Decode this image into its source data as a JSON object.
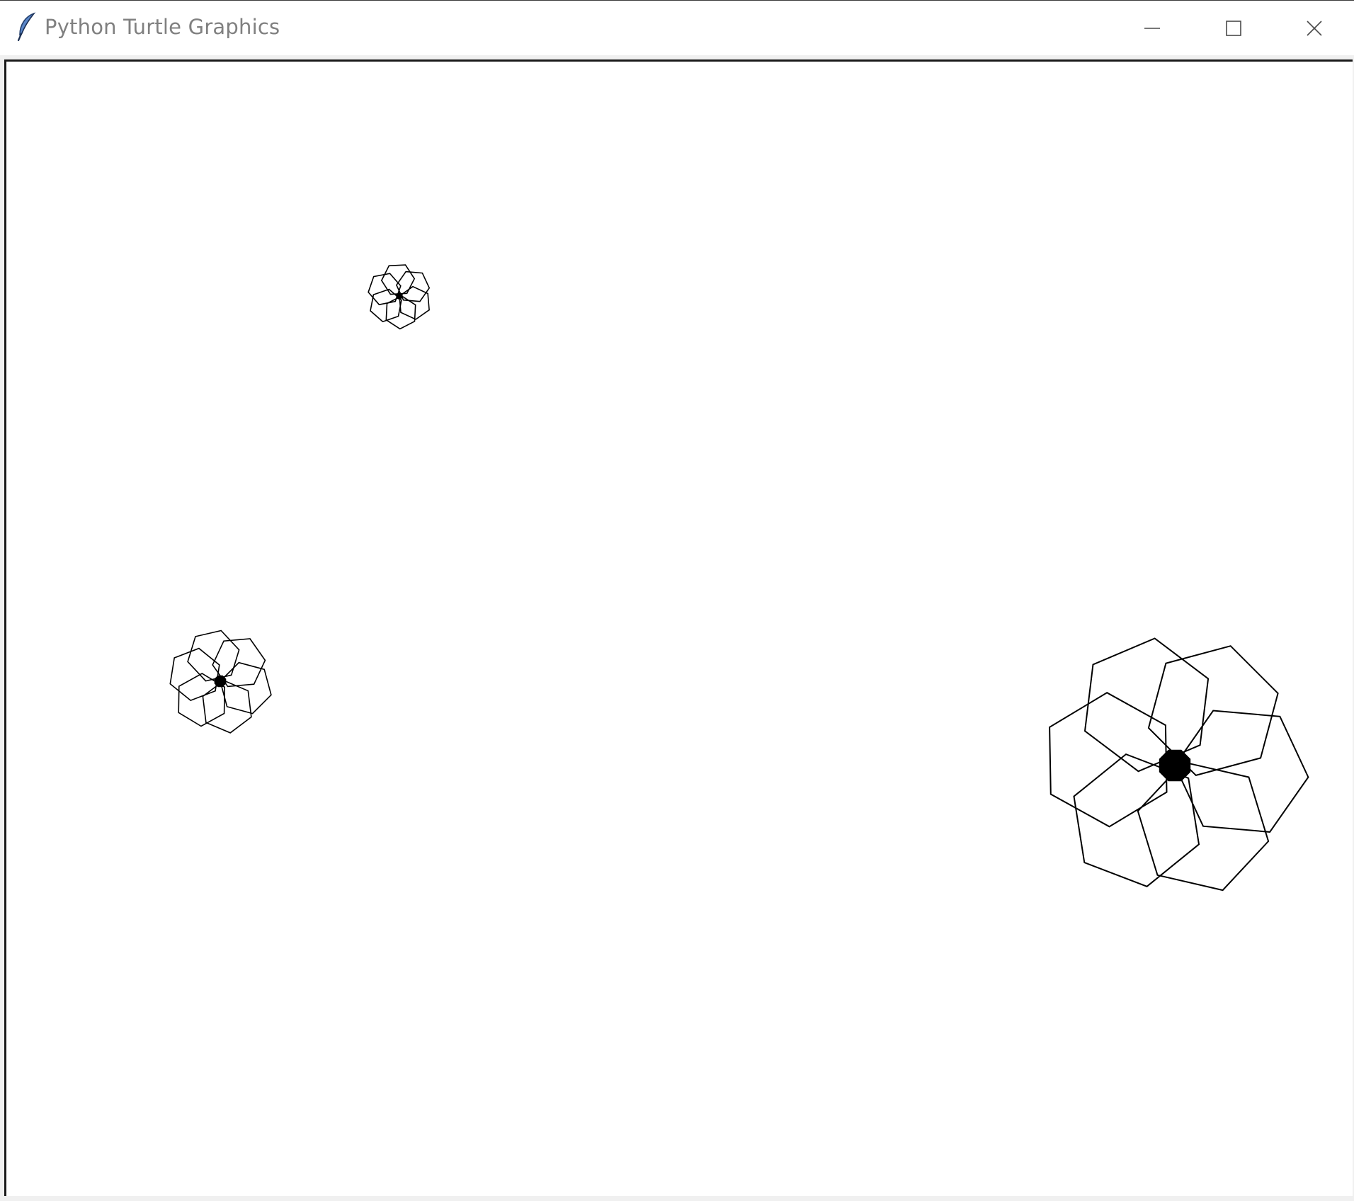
{
  "window": {
    "title": "Python Turtle Graphics"
  },
  "icons": {
    "app": "feather-icon",
    "minimize": "minimize-icon",
    "maximize": "maximize-icon",
    "close": "close-icon"
  },
  "canvas": {
    "background": "#ffffff",
    "pen_color": "#000000"
  }
}
